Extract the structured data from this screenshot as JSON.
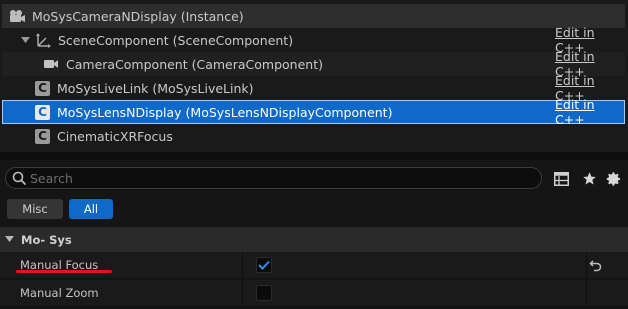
{
  "components": {
    "root": {
      "label": "MoSysCameraNDisplay (Instance)"
    },
    "items": [
      {
        "label": "SceneComponent (SceneComponent)",
        "link": "Edit in C++"
      },
      {
        "label": "CameraComponent (CameraComponent)",
        "link": "Edit in C++"
      },
      {
        "label": "MoSysLiveLink (MoSysLiveLink)",
        "link": "Edit in C++"
      },
      {
        "label": "MoSysLensNDisplay (MoSysLensNDisplayComponent)",
        "link": "Edit in C++"
      },
      {
        "label": "CinematicXRFocus"
      }
    ]
  },
  "search": {
    "placeholder": "Search"
  },
  "filters": {
    "misc": "Misc",
    "all": "All"
  },
  "category": {
    "label": "Mo- Sys"
  },
  "properties": [
    {
      "label": "Manual Focus",
      "checked": true
    },
    {
      "label": "Manual Zoom",
      "checked": false
    }
  ],
  "colors": {
    "accent": "#0e69c9",
    "highlight": "#e01515"
  }
}
